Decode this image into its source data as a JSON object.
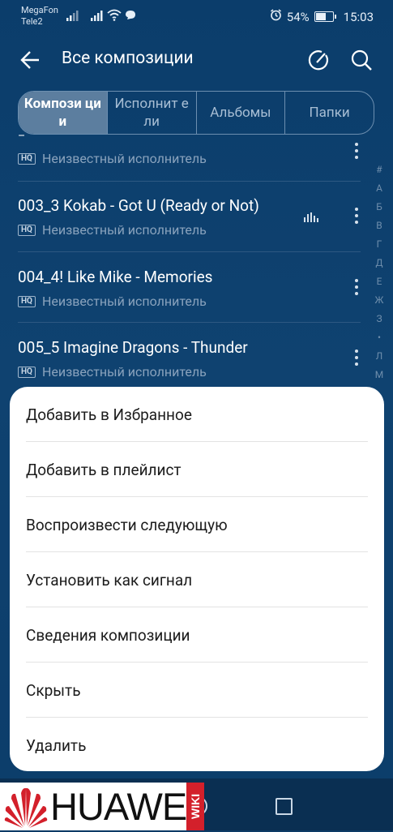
{
  "status": {
    "carrier1": "MegaFon",
    "carrier2": "Tele2",
    "battery": "54%",
    "battery_level": 0.54,
    "time": "15:03"
  },
  "toolbar": {
    "title": "Все композиции",
    "icons": [
      "back-arrow-icon",
      "edit-icon",
      "search-icon"
    ]
  },
  "tabs": [
    {
      "label": "Компози ции",
      "active": true
    },
    {
      "label": "Исполнит ели",
      "active": false
    },
    {
      "label": "Альбомы",
      "active": false
    },
    {
      "label": "Папки",
      "active": false
    }
  ],
  "songs": [
    {
      "title": "–",
      "artist": "Неизвестный исполнитель",
      "badge": "HQ"
    },
    {
      "title": "003_3 Kokab - Got U (Ready or Not)",
      "artist": "Неизвестный исполнитель",
      "badge": "HQ",
      "playing": true
    },
    {
      "title": "004_4! Like Mike - Memories",
      "artist": "Неизвестный исполнитель",
      "badge": "HQ"
    },
    {
      "title": "005_5 Imagine Dragons - Thunder",
      "artist": "Неизвестный исполнитель",
      "badge": "HQ"
    }
  ],
  "alphabet": [
    "#",
    "А",
    "Б",
    "В",
    "Г",
    "Д",
    "Е",
    "Ж",
    "З",
    "•",
    "Л",
    "М"
  ],
  "menu": {
    "items": [
      "Добавить в Избранное",
      "Добавить в плейлист",
      "Воспроизвести следующую",
      "Установить как сигнал",
      "Сведения композиции",
      "Скрыть",
      "Удалить"
    ]
  },
  "watermark": {
    "brand": "HUAWEI",
    "tag": "WIKI"
  },
  "colors": {
    "background": "#0f4270",
    "sheet": "#ffffff",
    "watermark_red": "#d3202b"
  }
}
